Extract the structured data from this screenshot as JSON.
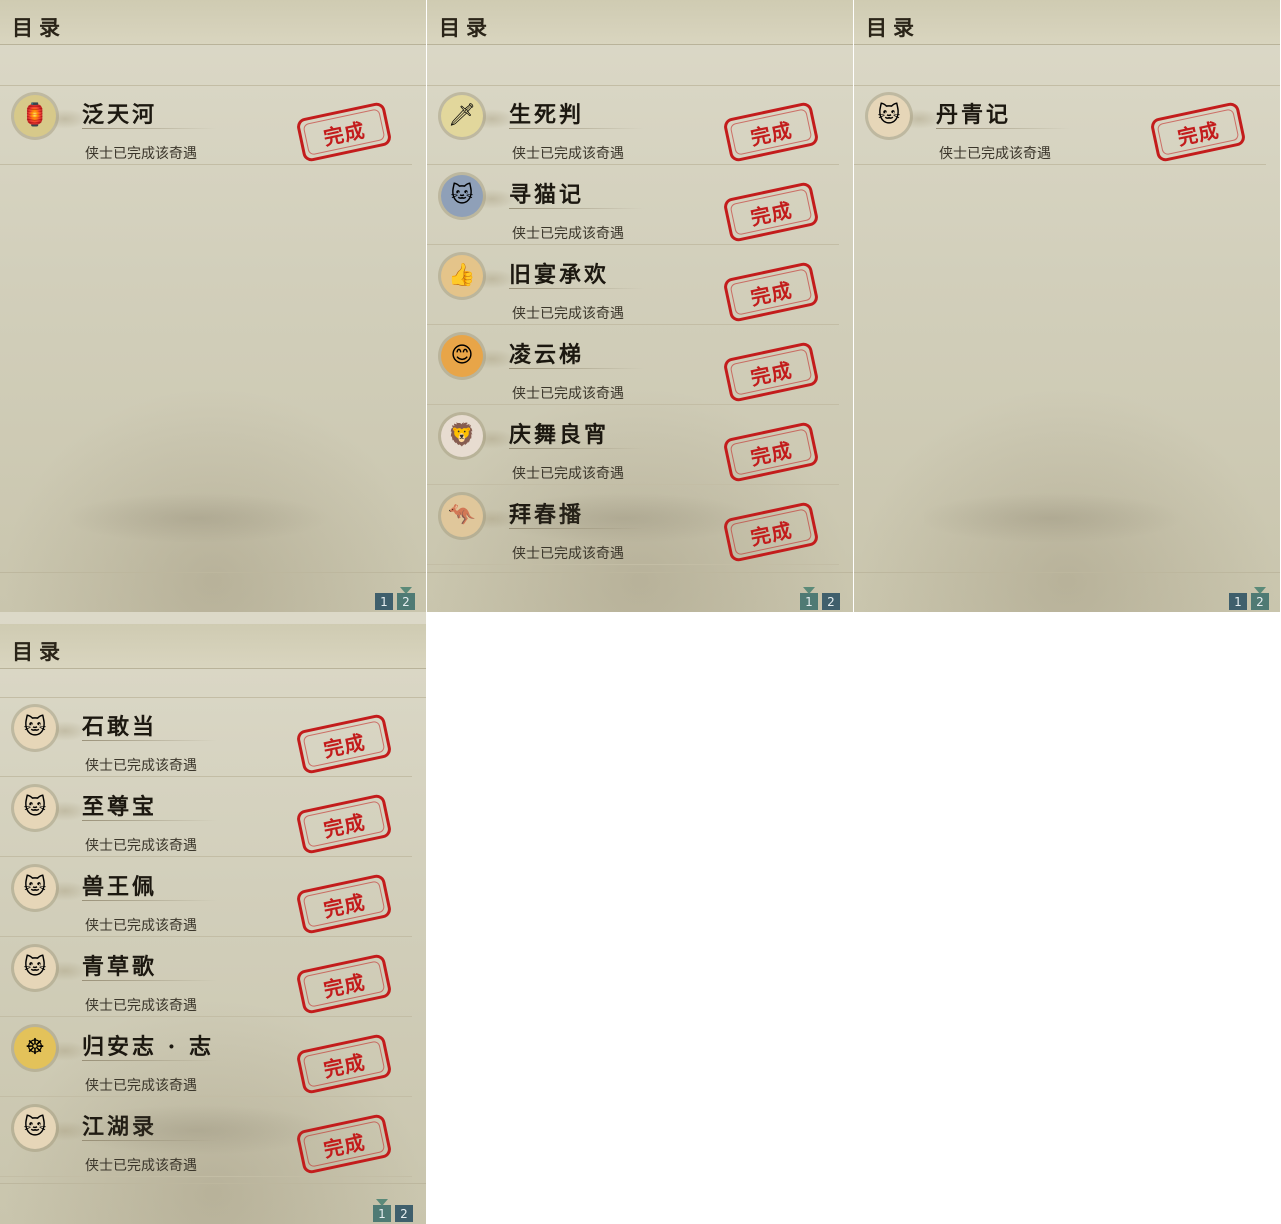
{
  "panels": [
    {
      "title": "目录",
      "items": [
        {
          "name": "泛天河",
          "status": "侠士已完成该奇遇",
          "stamp": "完成",
          "icon": "lantern-icon",
          "icon_glyph": "🏮",
          "icon_bg": "#d7c98a"
        }
      ],
      "pages": [
        "1",
        "2"
      ],
      "active_page": "2"
    },
    {
      "title": "目录",
      "items": [
        {
          "name": "生死判",
          "status": "侠士已完成该奇遇",
          "stamp": "完成",
          "icon": "blade-ingot-icon",
          "icon_glyph": "🗡",
          "icon_bg": "#e2d79c"
        },
        {
          "name": "寻猫记",
          "status": "侠士已完成该奇遇",
          "stamp": "完成",
          "icon": "raccoon-cat-icon",
          "icon_glyph": "🐱",
          "icon_bg": "#8fa0b8"
        },
        {
          "name": "旧宴承欢",
          "status": "侠士已完成该奇遇",
          "stamp": "完成",
          "icon": "thumbs-up-icon",
          "icon_glyph": "👍",
          "icon_bg": "#e4c48a"
        },
        {
          "name": "凌云梯",
          "status": "侠士已完成该奇遇",
          "stamp": "完成",
          "icon": "smiling-face-icon",
          "icon_glyph": "😊",
          "icon_bg": "#e8a548"
        },
        {
          "name": "庆舞良宵",
          "status": "侠士已完成该奇遇",
          "stamp": "完成",
          "icon": "lion-dance-icon",
          "icon_glyph": "🦁",
          "icon_bg": "#e7dcd0"
        },
        {
          "name": "拜春播",
          "status": "侠士已完成该奇遇",
          "stamp": "完成",
          "icon": "kangaroo-icon",
          "icon_glyph": "🦘",
          "icon_bg": "#e0c79b"
        }
      ],
      "pages": [
        "1",
        "2"
      ],
      "active_page": "1"
    },
    {
      "title": "目录",
      "items": [
        {
          "name": "丹青记",
          "status": "侠士已完成该奇遇",
          "stamp": "完成",
          "icon": "cat-face-icon",
          "icon_glyph": "🐱",
          "icon_bg": "#e6d6b8"
        }
      ],
      "pages": [
        "1",
        "2"
      ],
      "active_page": "2"
    },
    {
      "title": "目录",
      "items": [
        {
          "name": "石敢当",
          "status": "侠士已完成该奇遇",
          "stamp": "完成",
          "icon": "cat-face-icon",
          "icon_glyph": "🐱",
          "icon_bg": "#e6d6b8"
        },
        {
          "name": "至尊宝",
          "status": "侠士已完成该奇遇",
          "stamp": "完成",
          "icon": "cat-face-icon",
          "icon_glyph": "🐱",
          "icon_bg": "#e6d6b8"
        },
        {
          "name": "兽王佩",
          "status": "侠士已完成该奇遇",
          "stamp": "完成",
          "icon": "cat-face-icon",
          "icon_glyph": "🐱",
          "icon_bg": "#e6d6b8"
        },
        {
          "name": "青草歌",
          "status": "侠士已完成该奇遇",
          "stamp": "完成",
          "icon": "cat-face-icon",
          "icon_glyph": "🐱",
          "icon_bg": "#e6d6b8"
        },
        {
          "name": "归安志 · 志",
          "status": "侠士已完成该奇遇",
          "stamp": "完成",
          "icon": "golden-buddha-icon",
          "icon_glyph": "☸",
          "icon_bg": "#e3c25a"
        },
        {
          "name": "江湖录",
          "status": "侠士已完成该奇遇",
          "stamp": "完成",
          "icon": "cat-face-icon",
          "icon_glyph": "🐱",
          "icon_bg": "#e6d6b8"
        }
      ],
      "pages": [
        "1",
        "2"
      ],
      "active_page": "1"
    }
  ]
}
